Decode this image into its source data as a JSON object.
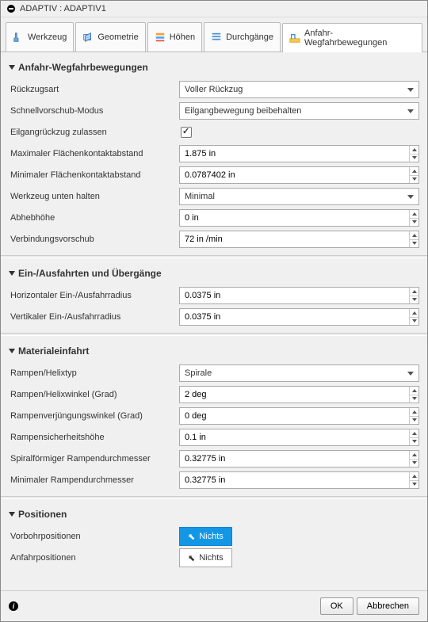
{
  "title": "ADAPTIV : ADAPTIV1",
  "tabs": {
    "tool": "Werkzeug",
    "geometry": "Geometrie",
    "heights": "Höhen",
    "passes": "Durchgänge",
    "linking": "Anfahr-Wegfahrbewegungen"
  },
  "sections": {
    "linking": {
      "title": "Anfahr-Wegfahrbewegungen",
      "fields": {
        "retractPolicy": {
          "label": "Rückzugsart",
          "value": "Voller Rückzug"
        },
        "highFeedMode": {
          "label": "Schnellvorschub-Modus",
          "value": "Eilgangbewegung beibehalten"
        },
        "allowRapid": {
          "label": "Eilgangrückzug zulassen",
          "checked": true
        },
        "maxStay": {
          "label": "Maximaler Flächenkontaktabstand",
          "value": "1.875 in"
        },
        "minStay": {
          "label": "Minimaler Flächenkontaktabstand",
          "value": "0.0787402 in"
        },
        "keepDownMode": {
          "label": "Werkzeug unten halten",
          "value": "Minimal"
        },
        "liftHeight": {
          "label": "Abhebhöhe",
          "value": "0 in"
        },
        "feedLink": {
          "label": "Verbindungsvorschub",
          "value": "72 in /min"
        }
      }
    },
    "leads": {
      "title": "Ein-/Ausfahrten und Übergänge",
      "fields": {
        "hRadius": {
          "label": "Horizontaler Ein-/Ausfahrradius",
          "value": "0.0375 in"
        },
        "vRadius": {
          "label": "Vertikaler Ein-/Ausfahrradius",
          "value": "0.0375 in"
        }
      }
    },
    "ramp": {
      "title": "Materialeinfahrt",
      "fields": {
        "rampType": {
          "label": "Rampen/Helixtyp",
          "value": "Spirale"
        },
        "rampAngle": {
          "label": "Rampen/Helixwinkel (Grad)",
          "value": "2 deg"
        },
        "taperAngle": {
          "label": "Rampenverjüngungswinkel (Grad)",
          "value": "0 deg"
        },
        "clearance": {
          "label": "Rampensicherheitshöhe",
          "value": "0.1 in"
        },
        "helixDia": {
          "label": "Spiralförmiger Rampendurchmesser",
          "value": "0.32775 in"
        },
        "minDia": {
          "label": "Minimaler Rampendurchmesser",
          "value": "0.32775 in"
        }
      }
    },
    "positions": {
      "title": "Positionen",
      "fields": {
        "predrill": {
          "label": "Vorbohrpositionen",
          "value": "Nichts"
        },
        "entry": {
          "label": "Anfahrpositionen",
          "value": "Nichts"
        }
      }
    }
  },
  "footer": {
    "ok": "OK",
    "cancel": "Abbrechen"
  }
}
